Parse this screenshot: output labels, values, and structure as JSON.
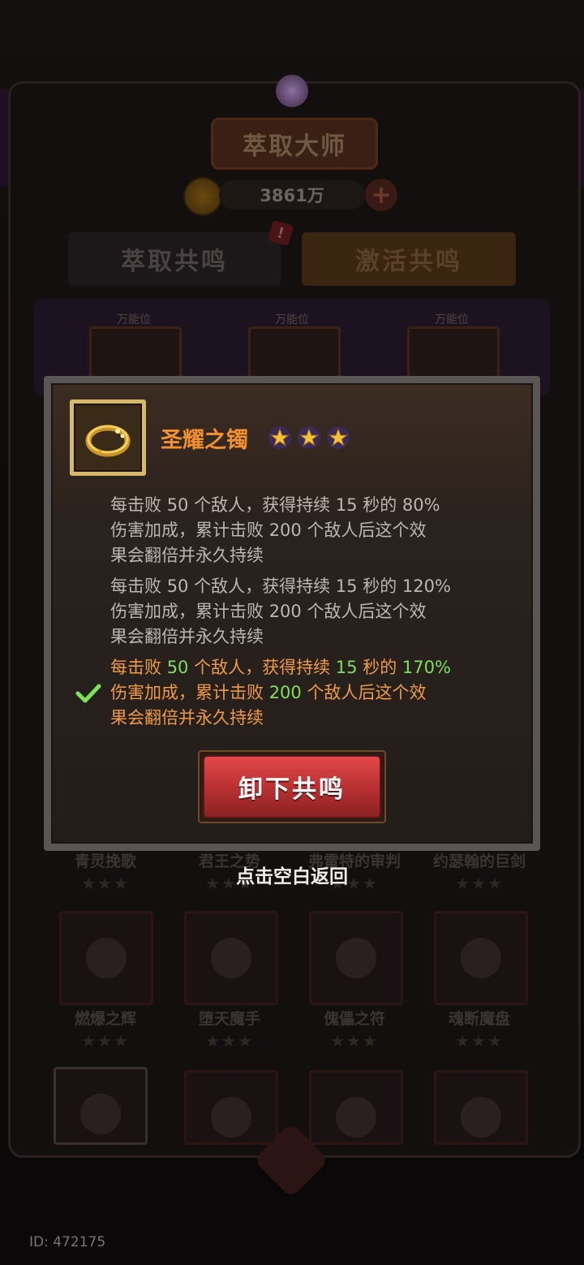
{
  "header": {
    "title": "萃取大师",
    "currency_value": "3861万"
  },
  "tabs": [
    {
      "label": "萃取共鸣"
    },
    {
      "label": "激活共鸣"
    }
  ],
  "tab_badge": "!",
  "slots": [
    {
      "label": "万能位"
    },
    {
      "label": "万能位"
    },
    {
      "label": "万能位"
    }
  ],
  "grid_row1": [
    {
      "name": "青灵挽歌",
      "stars": "★★★"
    },
    {
      "name": "君王之势",
      "stars": "★★★"
    },
    {
      "name": "弗雷特的审判",
      "stars": "★★★"
    },
    {
      "name": "约瑟翰的巨剑",
      "stars": "★★★"
    }
  ],
  "grid_row2": [
    {
      "name": "燃爆之辉",
      "stars": "★★★"
    },
    {
      "name": "堕天魔手",
      "stars": "★★★"
    },
    {
      "name": "傀儡之符",
      "stars": "★★★"
    },
    {
      "name": "魂断魔盘",
      "stars": "★★★"
    }
  ],
  "modal": {
    "item_name": "圣耀之镯",
    "star_count": 3,
    "tiers": [
      {
        "pre": "每击败 ",
        "n1": "50",
        "mid1": " 个敌人，获得持续 ",
        "n2": "15",
        "mid2": " 秒的 ",
        "n3": "80%",
        "l2a": "伤害加成，累计击败 ",
        "n4": "200",
        "l2b": " 个敌人后这个效",
        "l3": "果会翻倍并永久持续",
        "active": false
      },
      {
        "pre": "每击败 ",
        "n1": "50",
        "mid1": " 个敌人，获得持续 ",
        "n2": "15",
        "mid2": " 秒的 ",
        "n3": "120%",
        "l2a": "伤害加成，累计击败 ",
        "n4": "200",
        "l2b": " 个敌人后这个效",
        "l3": "果会翻倍并永久持续",
        "active": false
      },
      {
        "pre": "每击败 ",
        "n1": "50",
        "mid1": " 个敌人，获得持续 ",
        "n2": "15",
        "mid2": " 秒的 ",
        "n3": "170%",
        "l2a": "伤害加成，累计击败 ",
        "n4": "200",
        "l2b": " 个敌人后这个效",
        "l3": "果会翻倍并永久持续",
        "active": true
      }
    ],
    "button_label": "卸下共鸣"
  },
  "hint": "点击空白返回",
  "footer": {
    "id_text": "ID: 472175"
  },
  "colors": {
    "item_name": "#f1902d",
    "highlight": "#7be05a",
    "button": "#c83a3b"
  }
}
